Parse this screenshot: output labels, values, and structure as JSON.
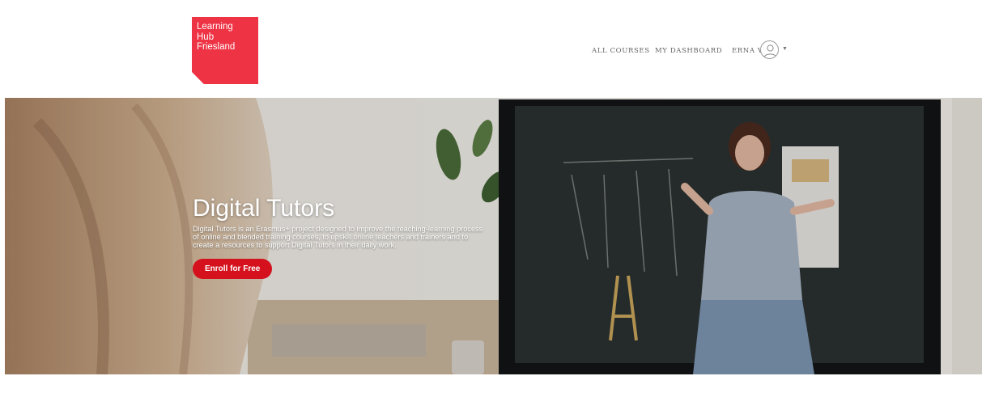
{
  "header": {
    "logo_lines": [
      "Learning",
      "Hub",
      "Friesland"
    ],
    "nav": {
      "all_courses": "ALL COURSES",
      "my_dashboard": "MY DASHBOARD",
      "user_name": "ERNA V",
      "user_caret_icon": "caret-down-icon",
      "avatar_icon": "user-avatar-icon"
    }
  },
  "hero": {
    "title": "Digital Tutors",
    "description": "Digital Tutors is an Erasmus+ project designed to improve the teaching-learning process of online and blended training courses, to upskill online teachers and trainers and to create a resources to support Digital Tutors in their daily work.",
    "cta_label": "Enroll for Free"
  },
  "colors": {
    "brand_red": "#ee3344",
    "cta_red": "#d4111d"
  }
}
